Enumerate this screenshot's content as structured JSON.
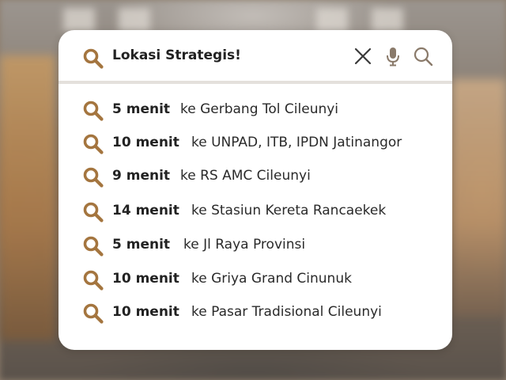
{
  "search": {
    "query": "Lokasi Strategis!",
    "leading_icon": "search-icon",
    "actions": [
      "close-icon",
      "microphone-icon",
      "search-icon"
    ]
  },
  "results": [
    {
      "time": "5 menit",
      "place": "ke Gerbang Tol Cileunyi"
    },
    {
      "time": "10 menit",
      "place": "ke UNPAD, ITB, IPDN Jatinangor"
    },
    {
      "time": "9 menit",
      "place": "ke RS AMC Cileunyi"
    },
    {
      "time": "14 menit",
      "place": "ke Stasiun Kereta Rancaekek"
    },
    {
      "time": "5 menit",
      "place": "ke Jl Raya Provinsi"
    },
    {
      "time": "10 menit",
      "place": "ke Griya Grand Cinunuk"
    },
    {
      "time": "10 menit",
      "place": "ke Pasar Tradisional Cileunyi"
    }
  ],
  "colors": {
    "accent": "#a4753f",
    "card": "#ffffff",
    "action_icon": "#3a3a3a",
    "action_icon_light": "#8a7a6a"
  }
}
